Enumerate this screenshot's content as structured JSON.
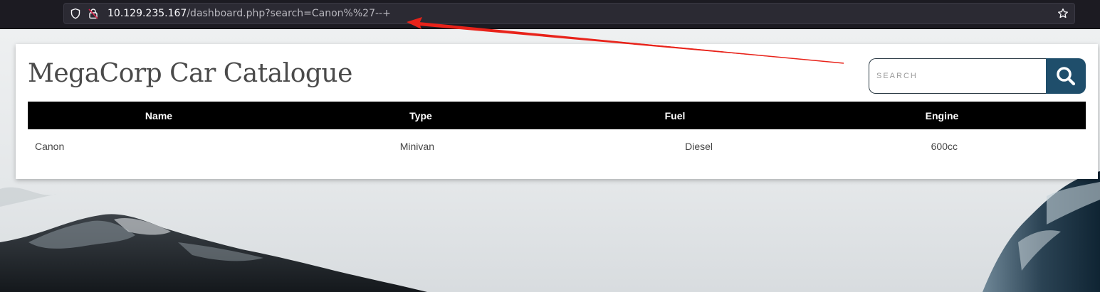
{
  "browser": {
    "url_host": "10.129.235.167",
    "url_path": "/dashboard.php?search=Canon%%27--+"
  },
  "page": {
    "title": "MegaCorp Car Catalogue"
  },
  "search": {
    "placeholder": "SEARCH",
    "value": ""
  },
  "table": {
    "headers": [
      "Name",
      "Type",
      "Fuel",
      "Engine"
    ],
    "rows": [
      [
        "Canon",
        "Minivan",
        "Diesel",
        "600cc"
      ]
    ]
  },
  "colors": {
    "browser_bg": "#1c1b22",
    "search_button": "#1f4e6b",
    "table_header_bg": "#000000",
    "annotation_arrow": "#e8231a"
  }
}
